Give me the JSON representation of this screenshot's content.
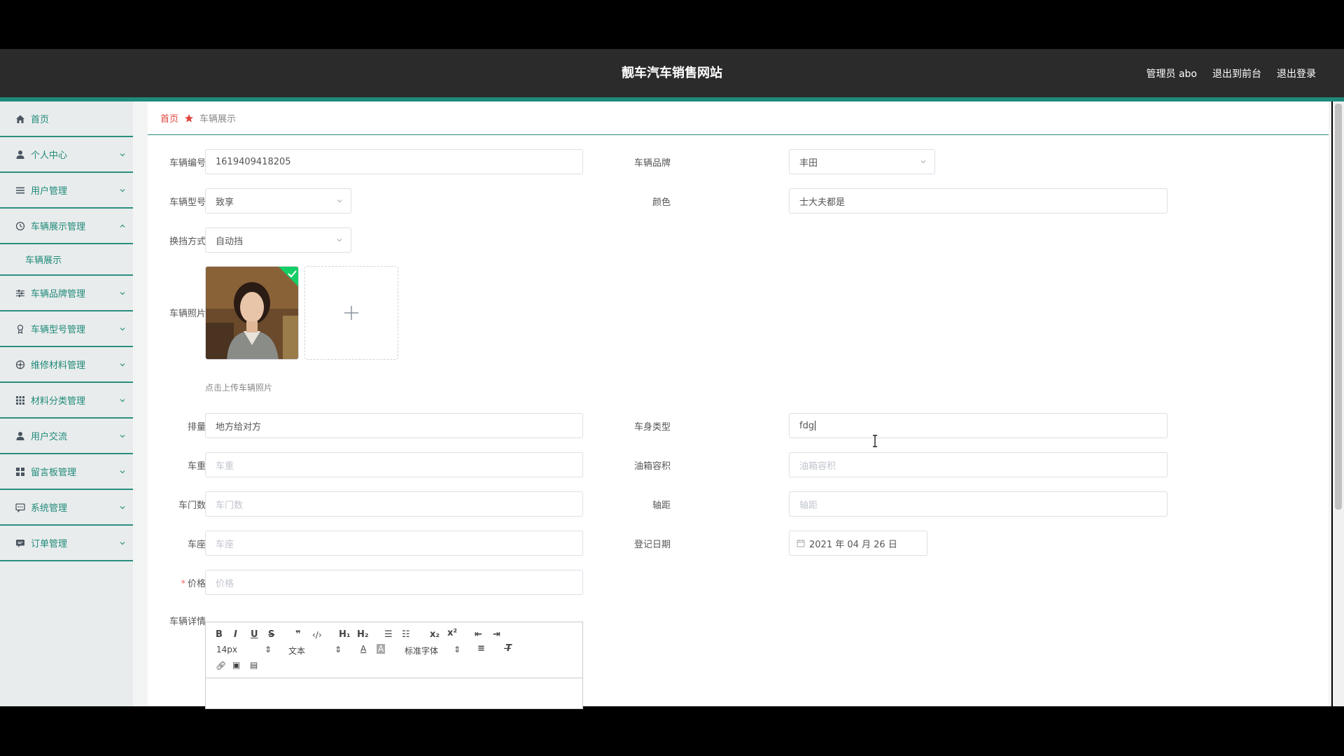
{
  "header": {
    "title": "靓车汽车销售网站",
    "admin": "管理员 abo",
    "to_front": "退出到前台",
    "logout": "退出登录"
  },
  "colors": {
    "accent": "#1f8a7a",
    "header_bg": "#2b2b2b",
    "home_red": "#e0473f"
  },
  "sidebar": {
    "items": [
      {
        "label": "首页",
        "icon": "home-icon"
      },
      {
        "label": "个人中心",
        "icon": "user-icon"
      },
      {
        "label": "用户管理",
        "icon": "list-icon"
      },
      {
        "label": "车辆展示管理",
        "icon": "clock-icon"
      },
      {
        "label": "车辆品牌管理",
        "icon": "sliders-icon"
      },
      {
        "label": "车辆型号管理",
        "icon": "badge-icon"
      },
      {
        "label": "维修材料管理",
        "icon": "wheel-icon"
      },
      {
        "label": "材料分类管理",
        "icon": "grid-icon"
      },
      {
        "label": "用户交流",
        "icon": "user-icon"
      },
      {
        "label": "留言板管理",
        "icon": "apps-icon"
      },
      {
        "label": "系统管理",
        "icon": "chat-icon"
      },
      {
        "label": "订单管理",
        "icon": "message-icon"
      }
    ],
    "sub_item": "车辆展示"
  },
  "breadcrumb": {
    "home": "首页",
    "current": "车辆展示"
  },
  "form": {
    "vehicle_no": {
      "label": "车辆编号",
      "value": "1619409418205"
    },
    "brand": {
      "label": "车辆品牌",
      "value": "丰田"
    },
    "model": {
      "label": "车辆型号",
      "value": "致享"
    },
    "color": {
      "label": "颜色",
      "value": "士大夫都是"
    },
    "gear": {
      "label": "换挡方式",
      "value": "自动挡"
    },
    "photo": {
      "label": "车辆照片",
      "tip": "点击上传车辆照片"
    },
    "displacement": {
      "label": "排量",
      "value": "地方给对方"
    },
    "body_type": {
      "label": "车身类型",
      "value": "fdg"
    },
    "weight": {
      "label": "车重",
      "placeholder": "车重"
    },
    "tank": {
      "label": "油箱容积",
      "placeholder": "油箱容积"
    },
    "doors": {
      "label": "车门数",
      "placeholder": "车门数"
    },
    "wheelbase": {
      "label": "轴距",
      "placeholder": "轴距"
    },
    "seats": {
      "label": "车座",
      "placeholder": "车座"
    },
    "reg_date": {
      "label": "登记日期",
      "value": "2021 年 04 月 26 日"
    },
    "price": {
      "label": "价格",
      "placeholder": "价格"
    },
    "details": {
      "label": "车辆详情"
    }
  },
  "editor": {
    "font_size": "14px",
    "block": "文本",
    "font": "标准字体",
    "h1": "H₁",
    "h2": "H₂",
    "sub": "x₂",
    "sup": "x²"
  }
}
